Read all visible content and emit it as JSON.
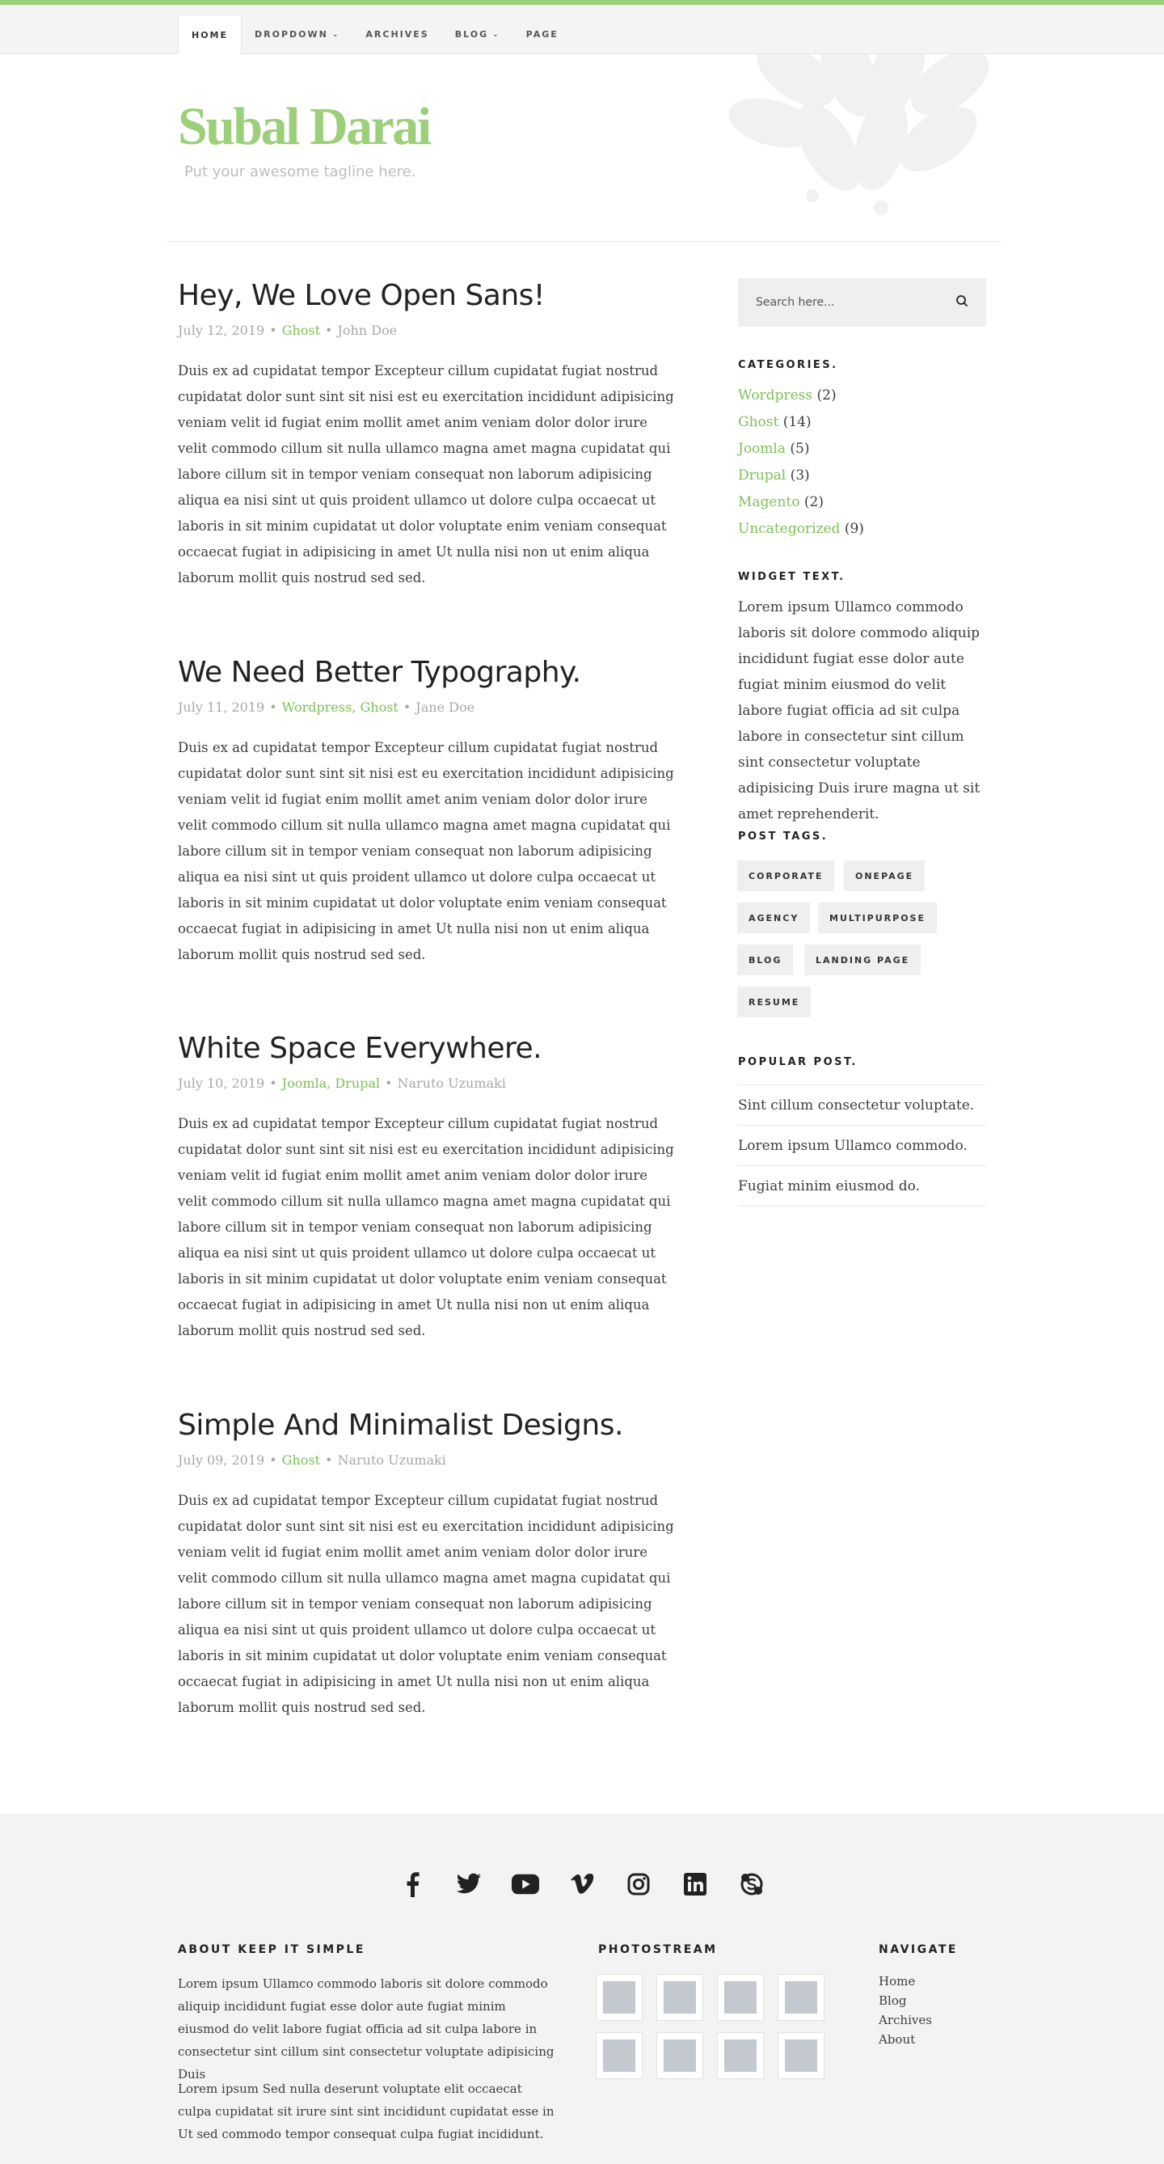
{
  "nav": {
    "items": [
      {
        "label": "HOME",
        "active": true
      },
      {
        "label": "DROPDOWN",
        "caret": true
      },
      {
        "label": "ARCHIVES"
      },
      {
        "label": "BLOG",
        "caret": true
      },
      {
        "label": "PAGE"
      }
    ]
  },
  "header": {
    "title": "Subal Darai",
    "tagline": "Put your awesome tagline here."
  },
  "posts": [
    {
      "title": "Hey, We Love Open Sans!",
      "date": "July 12, 2019",
      "categories": "Ghost",
      "author": "John Doe",
      "body": "Duis ex ad cupidatat tempor Excepteur cillum cupidatat fugiat nostrud cupidatat dolor sunt sint sit nisi est eu exercitation incididunt adipisicing veniam velit id fugiat enim mollit amet anim veniam dolor dolor irure velit commodo cillum sit nulla ullamco magna amet magna cupidatat qui labore cillum sit in tempor veniam consequat non laborum adipisicing aliqua ea nisi sint ut quis proident ullamco ut dolore culpa occaecat ut laboris in sit minim cupidatat ut dolor voluptate enim veniam consequat occaecat fugiat in adipisicing in amet Ut nulla nisi non ut enim aliqua laborum mollit quis nostrud sed sed."
    },
    {
      "title": "We Need Better Typography.",
      "date": "July 11, 2019",
      "categories": "Wordpress, Ghost",
      "author": "Jane Doe",
      "body": "Duis ex ad cupidatat tempor Excepteur cillum cupidatat fugiat nostrud cupidatat dolor sunt sint sit nisi est eu exercitation incididunt adipisicing veniam velit id fugiat enim mollit amet anim veniam dolor dolor irure velit commodo cillum sit nulla ullamco magna amet magna cupidatat qui labore cillum sit in tempor veniam consequat non laborum adipisicing aliqua ea nisi sint ut quis proident ullamco ut dolore culpa occaecat ut laboris in sit minim cupidatat ut dolor voluptate enim veniam consequat occaecat fugiat in adipisicing in amet Ut nulla nisi non ut enim aliqua laborum mollit quis nostrud sed sed."
    },
    {
      "title": "White Space Everywhere.",
      "date": "July 10, 2019",
      "categories": "Joomla, Drupal",
      "author": "Naruto Uzumaki",
      "body": "Duis ex ad cupidatat tempor Excepteur cillum cupidatat fugiat nostrud cupidatat dolor sunt sint sit nisi est eu exercitation incididunt adipisicing veniam velit id fugiat enim mollit amet anim veniam dolor dolor irure velit commodo cillum sit nulla ullamco magna amet magna cupidatat qui labore cillum sit in tempor veniam consequat non laborum adipisicing aliqua ea nisi sint ut quis proident ullamco ut dolore culpa occaecat ut laboris in sit minim cupidatat ut dolor voluptate enim veniam consequat occaecat fugiat in adipisicing in amet Ut nulla nisi non ut enim aliqua laborum mollit quis nostrud sed sed."
    },
    {
      "title": "Simple And Minimalist Designs.",
      "date": "July 09, 2019",
      "categories": "Ghost",
      "author": "Naruto Uzumaki",
      "body": "Duis ex ad cupidatat tempor Excepteur cillum cupidatat fugiat nostrud cupidatat dolor sunt sint sit nisi est eu exercitation incididunt adipisicing veniam velit id fugiat enim mollit amet anim veniam dolor dolor irure velit commodo cillum sit nulla ullamco magna amet magna cupidatat qui labore cillum sit in tempor veniam consequat non laborum adipisicing aliqua ea nisi sint ut quis proident ullamco ut dolore culpa occaecat ut laboris in sit minim cupidatat ut dolor voluptate enim veniam consequat occaecat fugiat in adipisicing in amet Ut nulla nisi non ut enim aliqua laborum mollit quis nostrud sed sed."
    }
  ],
  "sidebar": {
    "search_placeholder": "Search here...",
    "categories_title": "CATEGORIES.",
    "categories": [
      {
        "name": "Wordpress",
        "count": "(2)"
      },
      {
        "name": "Ghost",
        "count": "(14)"
      },
      {
        "name": "Joomla",
        "count": "(5)"
      },
      {
        "name": "Drupal",
        "count": "(3)"
      },
      {
        "name": "Magento",
        "count": "(2)"
      },
      {
        "name": "Uncategorized",
        "count": "(9)"
      }
    ],
    "widget_text_title": "WIDGET TEXT.",
    "widget_text": "Lorem ipsum Ullamco commodo laboris sit dolore commodo aliquip incididunt fugiat esse dolor aute fugiat minim eiusmod do velit labore fugiat officia ad sit culpa labore in consectetur sint cillum sint consectetur voluptate adipisicing Duis irure magna ut sit amet reprehenderit.",
    "tags_title": "POST TAGS.",
    "tags": [
      "CORPORATE",
      "ONEPAGE",
      "AGENCY",
      "MULTIPURPOSE",
      "BLOG",
      "LANDING PAGE",
      "RESUME"
    ],
    "popular_title": "POPULAR POST.",
    "popular": [
      "Sint cillum consectetur voluptate.",
      "Lorem ipsum Ullamco commodo.",
      "Fugiat minim eiusmod do."
    ]
  },
  "footer": {
    "social_icons": [
      "facebook-icon",
      "twitter-icon",
      "youtube-icon",
      "vimeo-icon",
      "instagram-icon",
      "linkedin-icon",
      "skype-icon"
    ],
    "about_title": "ABOUT KEEP IT SIMPLE",
    "about_p1": "Lorem ipsum Ullamco commodo laboris sit dolore commodo aliquip incididunt fugiat esse dolor aute fugiat minim eiusmod do velit labore fugiat officia ad sit culpa labore in consectetur sint cillum sint consectetur voluptate adipisicing Duis",
    "about_p2": "Lorem ipsum Sed nulla deserunt voluptate elit occaecat culpa cupidatat sit irure sint sint incididunt cupidatat esse in Ut sed commodo tempor consequat culpa fugiat incididunt.",
    "photostream_title": "PHOTOSTREAM",
    "navigate_title": "NAVIGATE",
    "navigate": [
      "Home",
      "Blog",
      "Archives",
      "About"
    ]
  },
  "colors": {
    "accent": "#9ccf7a",
    "link": "#7cbf55",
    "footer_bg": "#f3f3f3"
  }
}
